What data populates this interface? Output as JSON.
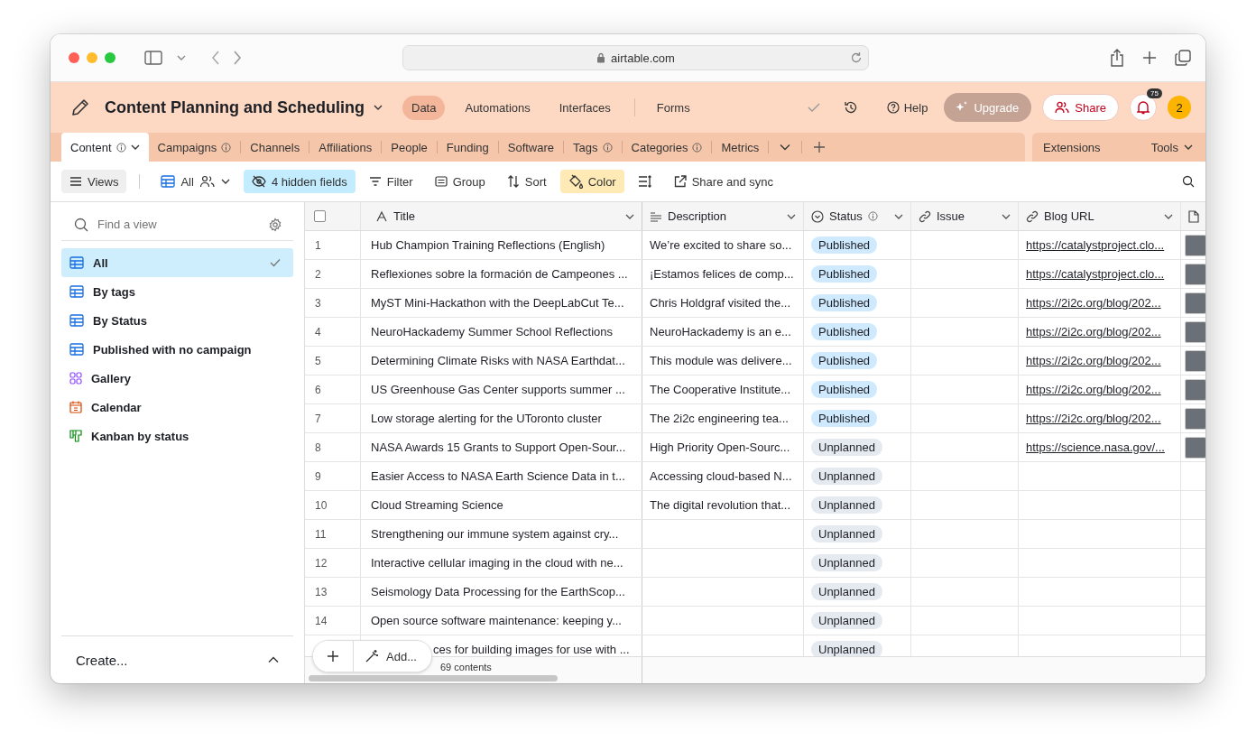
{
  "browser": {
    "address": "airtable.com"
  },
  "base": {
    "title": "Content Planning and Scheduling"
  },
  "app_nav": [
    {
      "label": "Data",
      "selected": true
    },
    {
      "label": "Automations",
      "selected": false
    },
    {
      "label": "Interfaces",
      "selected": false
    },
    {
      "label": "Forms",
      "selected": false
    }
  ],
  "header_actions": {
    "help": "Help",
    "upgrade": "Upgrade",
    "share": "Share",
    "notifications": "75",
    "avatar": "2"
  },
  "tables": [
    {
      "label": "Content",
      "info": true,
      "selected": true
    },
    {
      "label": "Campaigns",
      "info": true,
      "selected": false
    },
    {
      "label": "Channels",
      "info": false,
      "selected": false
    },
    {
      "label": "Affiliations",
      "info": false,
      "selected": false
    },
    {
      "label": "People",
      "info": false,
      "selected": false
    },
    {
      "label": "Funding",
      "info": false,
      "selected": false
    },
    {
      "label": "Software",
      "info": false,
      "selected": false
    },
    {
      "label": "Tags",
      "info": true,
      "selected": false
    },
    {
      "label": "Categories",
      "info": true,
      "selected": false
    },
    {
      "label": "Metrics",
      "info": false,
      "selected": false
    }
  ],
  "table_tools": [
    "Extensions",
    "Tools"
  ],
  "view_bar": [
    {
      "kind": "views",
      "label": "Views"
    },
    {
      "kind": "view",
      "label": "All"
    },
    {
      "kind": "hide",
      "label": "4 hidden fields",
      "color": "#c4ecff"
    },
    {
      "kind": "filter",
      "label": "Filter"
    },
    {
      "kind": "group",
      "label": "Group"
    },
    {
      "kind": "sort",
      "label": "Sort"
    },
    {
      "kind": "color",
      "label": "Color",
      "color": "#ffeab6"
    },
    {
      "kind": "height"
    },
    {
      "kind": "share",
      "label": "Share and sync"
    }
  ],
  "sidebar": {
    "search": {
      "placeholder": "Find a view"
    },
    "views": [
      {
        "kind": "grid",
        "label": "All",
        "selected": true
      },
      {
        "kind": "grid",
        "label": "By tags",
        "selected": false
      },
      {
        "kind": "grid",
        "label": "By Status",
        "selected": false
      },
      {
        "kind": "grid",
        "label": "Published with no campaign",
        "selected": false
      },
      {
        "kind": "gallery",
        "label": "Gallery",
        "selected": false
      },
      {
        "kind": "calendar",
        "label": "Calendar",
        "selected": false
      },
      {
        "kind": "kanban",
        "label": "Kanban by status",
        "selected": false
      }
    ],
    "create": "Create..."
  },
  "table": {
    "select_all": {
      "checked": false
    },
    "columns": [
      {
        "kind": "text",
        "label": "Title"
      },
      {
        "kind": "longtext",
        "label": "Description"
      },
      {
        "kind": "select",
        "label": "Status",
        "info": true
      },
      {
        "kind": "link",
        "label": "Issue"
      },
      {
        "kind": "url",
        "label": "Blog URL"
      },
      {
        "kind": "attachment"
      }
    ],
    "rows": [
      {
        "number": "1",
        "title": "Hub Champion Training Reflections (English)",
        "description": "We’re excited to share so...",
        "status": {
          "label": "Published",
          "color": "#cfeafe"
        },
        "blog_url": "https://catalystproject.clo...",
        "attachment": true
      },
      {
        "number": "2",
        "title": "Reflexiones sobre la formación de Campeones ...",
        "description": "¡Estamos felices de comp...",
        "status": {
          "label": "Published",
          "color": "#cfeafe"
        },
        "blog_url": "https://catalystproject.clo...",
        "attachment": true
      },
      {
        "number": "3",
        "title": "MyST Mini-Hackathon with the DeepLabCut Te...",
        "description": "Chris Holdgraf visited the...",
        "status": {
          "label": "Published",
          "color": "#cfeafe"
        },
        "blog_url": "https://2i2c.org/blog/202...",
        "attachment": true
      },
      {
        "number": "4",
        "title": "NeuroHackademy Summer School Reflections",
        "description": "NeuroHackademy is an e...",
        "status": {
          "label": "Published",
          "color": "#cfeafe"
        },
        "blog_url": "https://2i2c.org/blog/202...",
        "attachment": true
      },
      {
        "number": "5",
        "title": "Determining Climate Risks with NASA Earthdat...",
        "description": "This module was delivere...",
        "status": {
          "label": "Published",
          "color": "#cfeafe"
        },
        "blog_url": "https://2i2c.org/blog/202...",
        "attachment": true
      },
      {
        "number": "6",
        "title": "US Greenhouse Gas Center supports summer ...",
        "description": "The Cooperative Institute...",
        "status": {
          "label": "Published",
          "color": "#cfeafe"
        },
        "blog_url": "https://2i2c.org/blog/202...",
        "attachment": true
      },
      {
        "number": "7",
        "title": "Low storage alerting for the UToronto cluster",
        "description": "The 2i2c engineering tea...",
        "status": {
          "label": "Published",
          "color": "#cfeafe"
        },
        "blog_url": "https://2i2c.org/blog/202...",
        "attachment": true
      },
      {
        "number": "8",
        "title": "NASA Awards 15 Grants to Support Open-Sour...",
        "description": "High Priority Open-Sourc...",
        "status": {
          "label": "Unplanned",
          "color": "#e5e9f0"
        },
        "blog_url": "https://science.nasa.gov/...",
        "attachment": true
      },
      {
        "number": "9",
        "title": "Easier Access to NASA Earth Science Data in t...",
        "description": "Accessing cloud-based N...",
        "status": {
          "label": "Unplanned",
          "color": "#e5e9f0"
        },
        "attachment": false
      },
      {
        "number": "10",
        "title": "Cloud Streaming Science",
        "description": "The digital revolution that...",
        "status": {
          "label": "Unplanned",
          "color": "#e5e9f0"
        },
        "attachment": false
      },
      {
        "number": "11",
        "title": "Strengthening our immune system against cry...",
        "status": {
          "label": "Unplanned",
          "color": "#e5e9f0"
        },
        "attachment": false
      },
      {
        "number": "12",
        "title": "Interactive cellular imaging in the cloud with ne...",
        "status": {
          "label": "Unplanned",
          "color": "#e5e9f0"
        },
        "attachment": false
      },
      {
        "number": "13",
        "title": "Seismology Data Processing for the EarthScop...",
        "status": {
          "label": "Unplanned",
          "color": "#e5e9f0"
        },
        "attachment": false
      },
      {
        "number": "14",
        "title": "Open source software maintenance: keeping y...",
        "status": {
          "label": "Unplanned",
          "color": "#e5e9f0"
        },
        "attachment": false
      },
      {
        "title": "ces for building images for use with ...",
        "status": {
          "label": "Unplanned",
          "color": "#e5e9f0"
        },
        "attachment": false
      }
    ],
    "add_label": "Add...",
    "record_count": "69 contents"
  }
}
